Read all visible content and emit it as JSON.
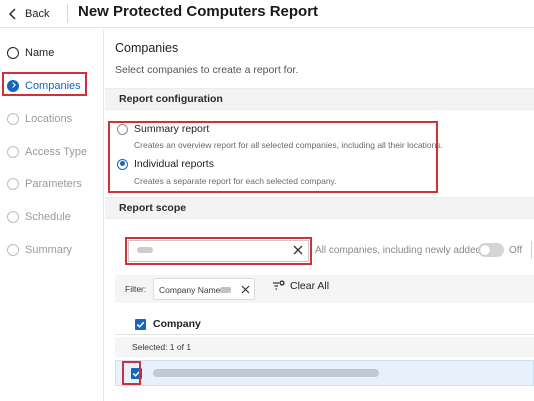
{
  "header": {
    "back_label": "Back",
    "title": "New Protected Computers Report"
  },
  "sidebar": {
    "steps": [
      {
        "label": "Name",
        "state": "done"
      },
      {
        "label": "Companies",
        "state": "active"
      },
      {
        "label": "Locations",
        "state": "pending"
      },
      {
        "label": "Access Type",
        "state": "pending"
      },
      {
        "label": "Parameters",
        "state": "pending"
      },
      {
        "label": "Schedule",
        "state": "pending"
      },
      {
        "label": "Summary",
        "state": "pending"
      }
    ]
  },
  "main": {
    "section_title": "Companies",
    "section_subtitle": "Select companies to create a report for.",
    "report_configuration": {
      "heading": "Report configuration",
      "options": [
        {
          "label": "Summary report",
          "description": "Creates an overview report for all selected companies, including all their locations.",
          "selected": false
        },
        {
          "label": "Individual reports",
          "description": "Creates a separate report for each selected company.",
          "selected": true
        }
      ]
    },
    "report_scope": {
      "heading": "Report scope",
      "all_companies_label": "All companies, including newly added",
      "toggle_state_label": "Off",
      "filter_label": "Filter:",
      "filter_chip_label": "Company Name:",
      "clear_all_label": "Clear All",
      "table": {
        "column_header": "Company",
        "selected_text": "Selected: 1 of 1"
      }
    }
  },
  "colors": {
    "accent": "#1565c0",
    "highlight_border": "#d0303a",
    "selected_row": "#e8f1fb"
  }
}
